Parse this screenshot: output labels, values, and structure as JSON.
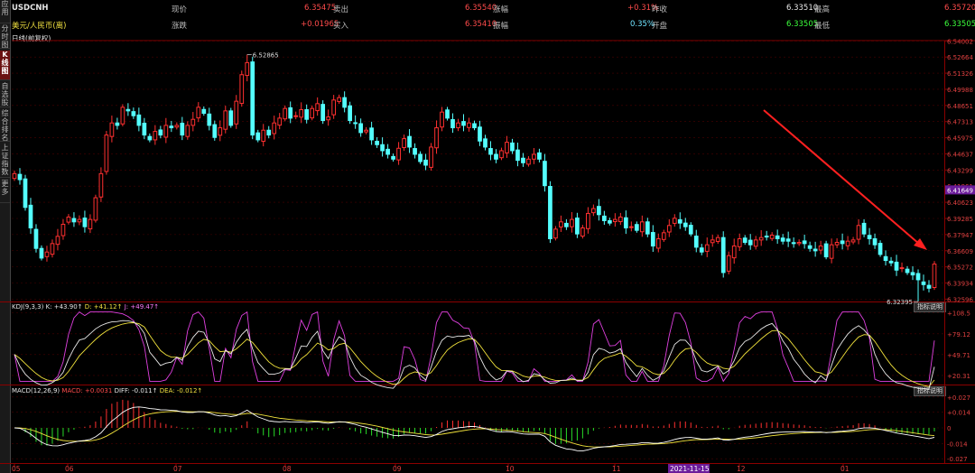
{
  "sidebar": {
    "items": [
      {
        "label": "应用"
      },
      {
        "label": "分时图"
      },
      {
        "label": "K线图",
        "active": true
      },
      {
        "label": "自选股"
      },
      {
        "label": "综合排名"
      },
      {
        "label": "上证指数"
      },
      {
        "label": "更多"
      }
    ]
  },
  "quote": {
    "symbol": "USDCNH",
    "name": "美元/人民币(离)",
    "period": "日线(前复权)",
    "fields": [
      {
        "label": "现价",
        "value": "6.35475"
      },
      {
        "label": "卖出",
        "value": "6.35540"
      },
      {
        "label": "涨幅",
        "value": "+0.31%"
      },
      {
        "label": "昨收",
        "value": "6.33510"
      },
      {
        "label": "最高",
        "value": "6.35720"
      },
      {
        "label": "涨跌",
        "value": "+0.01965"
      },
      {
        "label": "买入",
        "value": "6.35410"
      },
      {
        "label": "振幅",
        "value": "0.35%"
      },
      {
        "label": "开盘",
        "value": "6.33505"
      },
      {
        "label": "最低",
        "value": "6.33505"
      }
    ]
  },
  "chart_data": [
    {
      "type": "candlestick",
      "yticks": [
        "6.54002",
        "6.52664",
        "6.51326",
        "6.49988",
        "6.48651",
        "6.47313",
        "6.45975",
        "6.44637",
        "6.43299",
        "6.41961",
        "6.40623",
        "6.39285",
        "6.37947",
        "6.36609",
        "6.35272",
        "6.33934",
        "6.32596"
      ],
      "ylim": [
        6.324,
        6.541
      ],
      "current_price_label": "6.41649",
      "annotations": [
        {
          "text": "6.52865",
          "value": 6.52865
        },
        {
          "text": "6.32395",
          "value": 6.32395
        }
      ],
      "xlabels": [
        "05",
        "06",
        "07",
        "08",
        "09",
        "10",
        "11",
        "2021-11-15",
        "12",
        "01"
      ],
      "highlighted_xlabel": "2021-11-15",
      "series": [
        {
          "close": [
            6.43,
            6.425,
            6.402,
            6.385,
            6.368,
            6.36,
            6.365,
            6.372,
            6.378,
            6.388,
            6.394,
            6.39,
            6.392,
            6.386,
            6.392,
            6.41,
            6.43,
            6.462,
            6.472,
            6.47,
            6.485,
            6.482,
            6.478,
            6.47,
            6.462,
            6.458,
            6.465,
            6.462,
            6.47,
            6.468,
            6.47,
            6.462,
            6.47,
            6.475,
            6.485,
            6.48,
            6.47,
            6.46,
            6.468,
            6.482,
            6.47,
            6.49,
            6.512,
            6.522,
            6.462,
            6.458,
            6.466,
            6.462,
            6.472,
            6.476,
            6.484,
            6.476,
            6.478,
            6.483,
            6.475,
            6.484,
            6.488,
            6.474,
            6.477,
            6.491,
            6.493,
            6.485,
            6.474,
            6.472,
            6.464,
            6.466,
            6.458,
            6.454,
            6.449,
            6.446,
            6.442,
            6.451,
            6.459,
            6.452,
            6.446,
            6.44,
            6.437,
            6.452,
            6.468,
            6.481,
            6.476,
            6.468,
            6.472,
            6.47,
            6.472,
            6.468,
            6.457,
            6.452,
            6.446,
            6.442,
            6.449,
            6.456,
            6.449,
            6.441,
            6.439,
            6.442,
            6.446,
            6.442,
            6.42,
            6.376,
            6.384,
            6.39,
            6.386,
            6.392,
            6.38,
            6.385,
            6.397,
            6.401,
            6.396,
            6.391,
            6.389,
            6.392,
            6.394,
            6.385,
            6.386,
            6.383,
            6.39,
            6.38,
            6.37,
            6.376,
            6.381,
            6.387,
            6.393,
            6.389,
            6.386,
            6.38,
            6.369,
            6.365,
            6.371,
            6.375,
            6.377,
            6.348,
            6.362,
            6.37,
            6.376,
            6.373,
            6.371,
            6.375,
            6.377,
            6.378,
            6.379,
            6.376,
            6.374,
            6.374,
            6.372,
            6.373,
            6.372,
            6.368,
            6.366,
            6.37,
            6.361,
            6.371,
            6.373,
            6.372,
            6.374,
            6.375,
            6.387,
            6.38,
            6.376,
            6.371,
            6.363,
            6.358,
            6.356,
            6.35,
            6.352,
            6.348,
            6.346,
            6.342,
            6.338,
            6.335,
            6.355
          ]
        }
      ]
    },
    {
      "type": "line",
      "title": "KDJ(9,3,3)",
      "legend": [
        {
          "text": "KDJ(9,3,3)"
        },
        {
          "text": "K: +43.90↑"
        },
        {
          "text": "D: +41.12↑"
        },
        {
          "text": "J: +49.47↑"
        }
      ],
      "yticks": [
        "+108.5",
        "+79.12",
        "+49.71",
        "+20.31"
      ],
      "button": "指标说明"
    },
    {
      "type": "bar",
      "title": "MACD(12,26,9)",
      "legend": [
        {
          "text": "MACD(12,26,9)"
        },
        {
          "text": "MACD: +0.0031"
        },
        {
          "text": "DIFF: -0.011↑"
        },
        {
          "text": "DEA: -0.012↑"
        }
      ],
      "yticks": [
        "+0.027",
        "+0.014",
        "0",
        "-0.014",
        "-0.027"
      ],
      "button": "指标说明"
    }
  ],
  "colors": {
    "up": "#ff3030",
    "down": "#54ffff",
    "K": "#e8e8e8",
    "D": "#f2e33c",
    "J": "#e040e0",
    "DIFF": "#ffffff",
    "DEA": "#f2e33c",
    "MACDpos": "#ff3030",
    "MACDneg": "#28dd28",
    "grid": "#4a0000",
    "axis": "#8b0000",
    "arrow": "#ff2020"
  }
}
